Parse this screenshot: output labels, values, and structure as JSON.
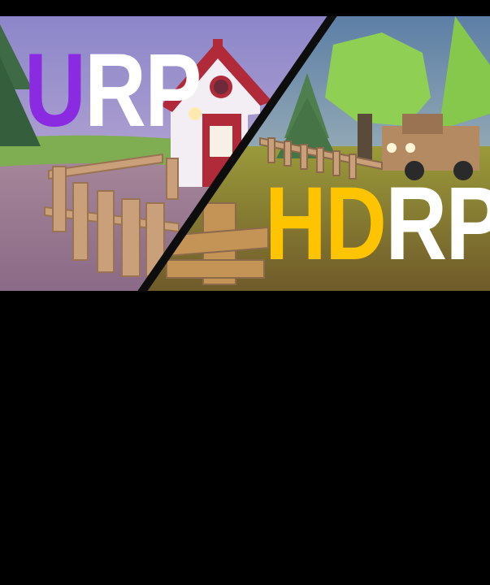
{
  "thumbnail": {
    "left_title": {
      "accent": "U",
      "rest": "RP"
    },
    "right_title": {
      "accent": "HD",
      "rest": "RP"
    }
  },
  "colors": {
    "urp_accent": "#8a2be2",
    "hdrp_accent": "#ffc400",
    "title_text": "#ffffff",
    "background": "#000000",
    "divider": "#111111"
  }
}
